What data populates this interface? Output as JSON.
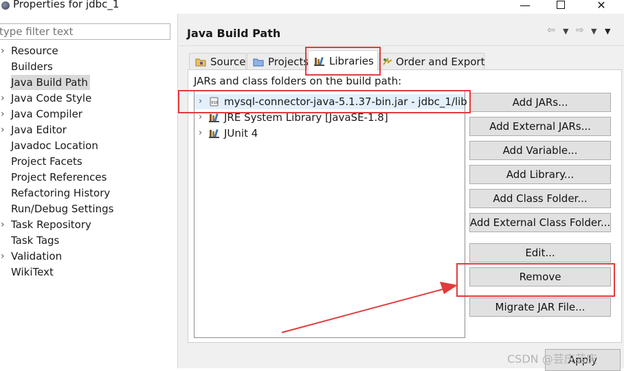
{
  "window": {
    "title": "Properties for jdbc_1",
    "minimize_glyph": "—",
    "close_glyph": "✕"
  },
  "left_pane": {
    "filter_placeholder": "type filter text",
    "items": [
      {
        "label": "Resource",
        "expandable": true
      },
      {
        "label": "Builders",
        "expandable": false
      },
      {
        "label": "Java Build Path",
        "expandable": false,
        "selected": true
      },
      {
        "label": "Java Code Style",
        "expandable": true
      },
      {
        "label": "Java Compiler",
        "expandable": true
      },
      {
        "label": "Java Editor",
        "expandable": true
      },
      {
        "label": "Javadoc Location",
        "expandable": false
      },
      {
        "label": "Project Facets",
        "expandable": false
      },
      {
        "label": "Project References",
        "expandable": false
      },
      {
        "label": "Refactoring History",
        "expandable": false
      },
      {
        "label": "Run/Debug Settings",
        "expandable": false
      },
      {
        "label": "Task Repository",
        "expandable": true
      },
      {
        "label": "Task Tags",
        "expandable": false
      },
      {
        "label": "Validation",
        "expandable": true
      },
      {
        "label": "WikiText",
        "expandable": false
      }
    ]
  },
  "main": {
    "title": "Java Build Path",
    "tabs": [
      {
        "label": "Source",
        "icon": "source-folder-icon"
      },
      {
        "label": "Projects",
        "icon": "projects-icon"
      },
      {
        "label": "Libraries",
        "icon": "libraries-icon",
        "active": true
      },
      {
        "label": "Order and Export",
        "icon": "order-export-icon"
      }
    ],
    "panel_label": "JARs and class folders on the build path:",
    "tree": [
      {
        "label": "mysql-connector-java-5.1.37-bin.jar - jdbc_1/lib",
        "icon": "jar-icon",
        "selected": true
      },
      {
        "label": "JRE System Library [JavaSE-1.8]",
        "icon": "library-icon"
      },
      {
        "label": "JUnit 4",
        "icon": "library-icon"
      }
    ],
    "buttons": {
      "add_jars": "Add JARs...",
      "add_external_jars": "Add External JARs...",
      "add_variable": "Add Variable...",
      "add_library": "Add Library...",
      "add_class_folder": "Add Class Folder...",
      "add_external_class_folder": "Add External Class Folder...",
      "edit": "Edit...",
      "remove": "Remove",
      "migrate_jar": "Migrate JAR File..."
    },
    "apply_label": "Apply"
  },
  "watermark": "CSDN @芸庆芸庆",
  "colors": {
    "annotation_red": "#e23b3b",
    "selection_blue": "#e3f0fc",
    "nav_selected": "#d9d9d9"
  }
}
